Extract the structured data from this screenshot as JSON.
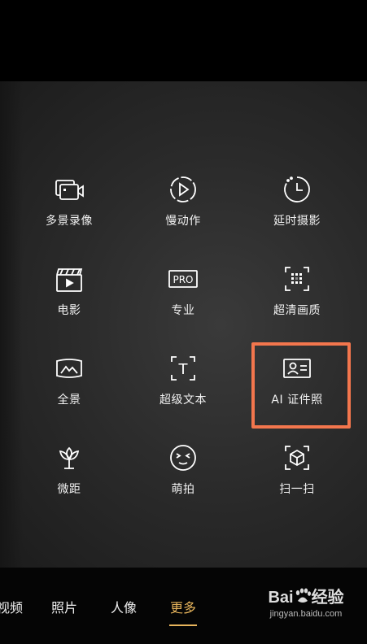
{
  "modes": [
    {
      "label": "多景录像",
      "icon": "multi-view-camera-icon"
    },
    {
      "label": "慢动作",
      "icon": "slow-motion-icon"
    },
    {
      "label": "延时摄影",
      "icon": "time-lapse-icon"
    },
    {
      "label": "电影",
      "icon": "clapperboard-icon"
    },
    {
      "label": "专业",
      "icon": "pro-icon"
    },
    {
      "label": "超清画质",
      "icon": "high-resolution-icon"
    },
    {
      "label": "全景",
      "icon": "panorama-icon"
    },
    {
      "label": "超级文本",
      "icon": "super-text-icon"
    },
    {
      "label": "AI 证件照",
      "icon": "id-photo-icon"
    },
    {
      "label": "微距",
      "icon": "macro-flower-icon"
    },
    {
      "label": "萌拍",
      "icon": "cute-face-icon"
    },
    {
      "label": "扫一扫",
      "icon": "scan-icon"
    }
  ],
  "pro_icon_text": "PRO",
  "super_text_icon_text": "T",
  "tabs": [
    {
      "label": "视频"
    },
    {
      "label": "照片"
    },
    {
      "label": "人像"
    },
    {
      "label": "更多",
      "active": true
    }
  ],
  "watermark": {
    "brand_a": "Bai",
    "brand_b": "经验",
    "url": "jingyan.baidu.com"
  },
  "colors": {
    "accent": "#e8b55c",
    "highlight": "#f3764d"
  }
}
